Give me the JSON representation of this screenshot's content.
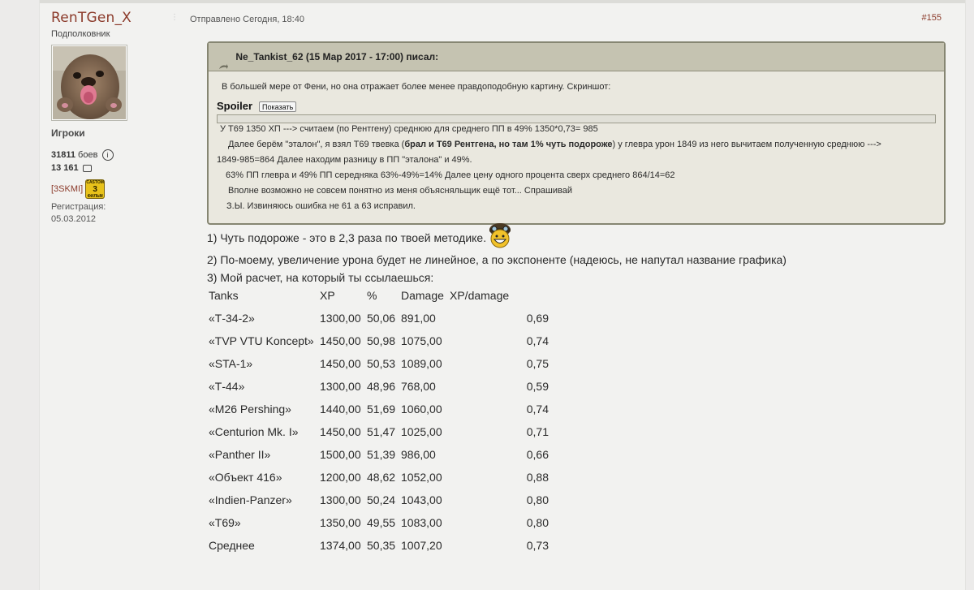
{
  "user": {
    "name": "RenTGen_X",
    "rank": "Подполковник",
    "group": "Игроки",
    "battles_value": "31811",
    "battles_label": "боев",
    "posts_value": "13 161",
    "clan": "[3SKMI]",
    "badge_small": "CASTOM",
    "badge_num": "3",
    "badge_sub": "ФИЛЬМ",
    "reg_label": "Регистрация:",
    "reg_date": "05.03.2012"
  },
  "post": {
    "date": "Отправлено Сегодня, 18:40",
    "number": "#155"
  },
  "quote": {
    "header": "Ne_Tankist_62 (15 Мар 2017 - 17:00) писал:",
    "intro": "В большей мере от Фени, но она отражает более менее правдоподобную картину.  Скриншот:",
    "spoiler_label": "Spoiler",
    "spoiler_button": "Показать",
    "lines": [
      "У  Т69    1350 ХП  --->  считаем (по Рентгену) среднюю для среднего ПП в 49%   1350*0,73= 985",
      "Далее берём \"эталон\", я взял Т69 твевка (",
      "брал и Т69 Рентгена, но там 1% чуть подороже",
      ") у глевра урон 1849 из него вычитаем полученную среднюю --->",
      "1849-985=864   Далее находим разницу в ПП \"эталона\" и 49%.",
      "63% ПП глевра  и 49% ПП середняка    63%-49%=14% Далее цену одного процента сверх среднего   864/14=62",
      "Вполне возможно не совсем понятно из меня объясняльщик ещё тот... Спрашивай",
      "З.Ы.  Извиняюсь ошибка не 61 а 63 исправил."
    ]
  },
  "body": {
    "line1": "1) Чуть подороже - это в 2,3 раза по твоей методике.",
    "line2": "2) По-моему, увеличение урона будет не линейное, а по экспоненте (надеюсь, не напутал название графика)",
    "line3": "3) Мой расчет, на который ты ссылаешься:"
  },
  "table": {
    "headers": [
      "Tanks",
      "XP",
      "%",
      "Damage",
      "XP/damage"
    ],
    "rows": [
      [
        "«Т-34-2»",
        "1300,00",
        "50,06",
        "891,00",
        "0,69"
      ],
      [
        "«TVP VTU Koncept»",
        "1450,00",
        "50,98",
        "1075,00",
        "0,74"
      ],
      [
        "«STA-1»",
        "1450,00",
        "50,53",
        "1089,00",
        "0,75"
      ],
      [
        "«Т-44»",
        "1300,00",
        "48,96",
        "768,00",
        "0,59"
      ],
      [
        "«M26 Pershing»",
        "1440,00",
        "51,69",
        "1060,00",
        "0,74"
      ],
      [
        "«Centurion Mk. I»",
        "1450,00",
        "51,47",
        "1025,00",
        "0,71"
      ],
      [
        "«Panther II»",
        "1500,00",
        "51,39",
        "986,00",
        "0,66"
      ],
      [
        "«Объект 416»",
        "1200,00",
        "48,62",
        "1052,00",
        "0,88"
      ],
      [
        "«Indien-Panzer»",
        "1300,00",
        "50,24",
        "1043,00",
        "0,80"
      ],
      [
        "«Т69»",
        "1350,00",
        "49,55",
        "1083,00",
        "0,80"
      ],
      [
        "Среднее",
        "1374,00",
        "50,35",
        "1007,20",
        "0,73"
      ]
    ]
  },
  "colors": {
    "link": "#8b3a2a",
    "quote_header_bg": "#c5c3b1",
    "quote_border": "#868672",
    "page_bg": "#f2f2f0"
  }
}
